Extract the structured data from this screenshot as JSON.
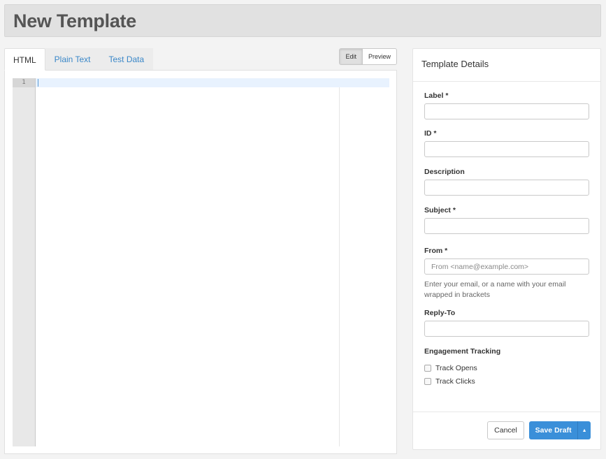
{
  "page": {
    "title": "New Template"
  },
  "editor": {
    "tabs": [
      {
        "label": "HTML",
        "active": true
      },
      {
        "label": "Plain Text",
        "active": false
      },
      {
        "label": "Test Data",
        "active": false
      }
    ],
    "modes": {
      "edit": "Edit",
      "preview": "Preview"
    },
    "line_number": "1"
  },
  "details": {
    "title": "Template Details",
    "label_field": {
      "label": "Label *",
      "value": ""
    },
    "id_field": {
      "label": "ID *",
      "value": ""
    },
    "description_field": {
      "label": "Description",
      "value": ""
    },
    "subject_field": {
      "label": "Subject *",
      "value": ""
    },
    "from_field": {
      "label": "From *",
      "placeholder": "From <name@example.com>",
      "help": "Enter your email, or a name with your email wrapped in brackets"
    },
    "reply_to_field": {
      "label": "Reply-To",
      "value": ""
    },
    "tracking": {
      "label": "Engagement Tracking",
      "track_opens": "Track Opens",
      "track_clicks": "Track Clicks"
    },
    "cancel_label": "Cancel",
    "save_label": "Save Draft"
  },
  "colors": {
    "accent": "#3a8fd9",
    "link": "#3a87c8",
    "header_bg": "#e1e1e1"
  }
}
